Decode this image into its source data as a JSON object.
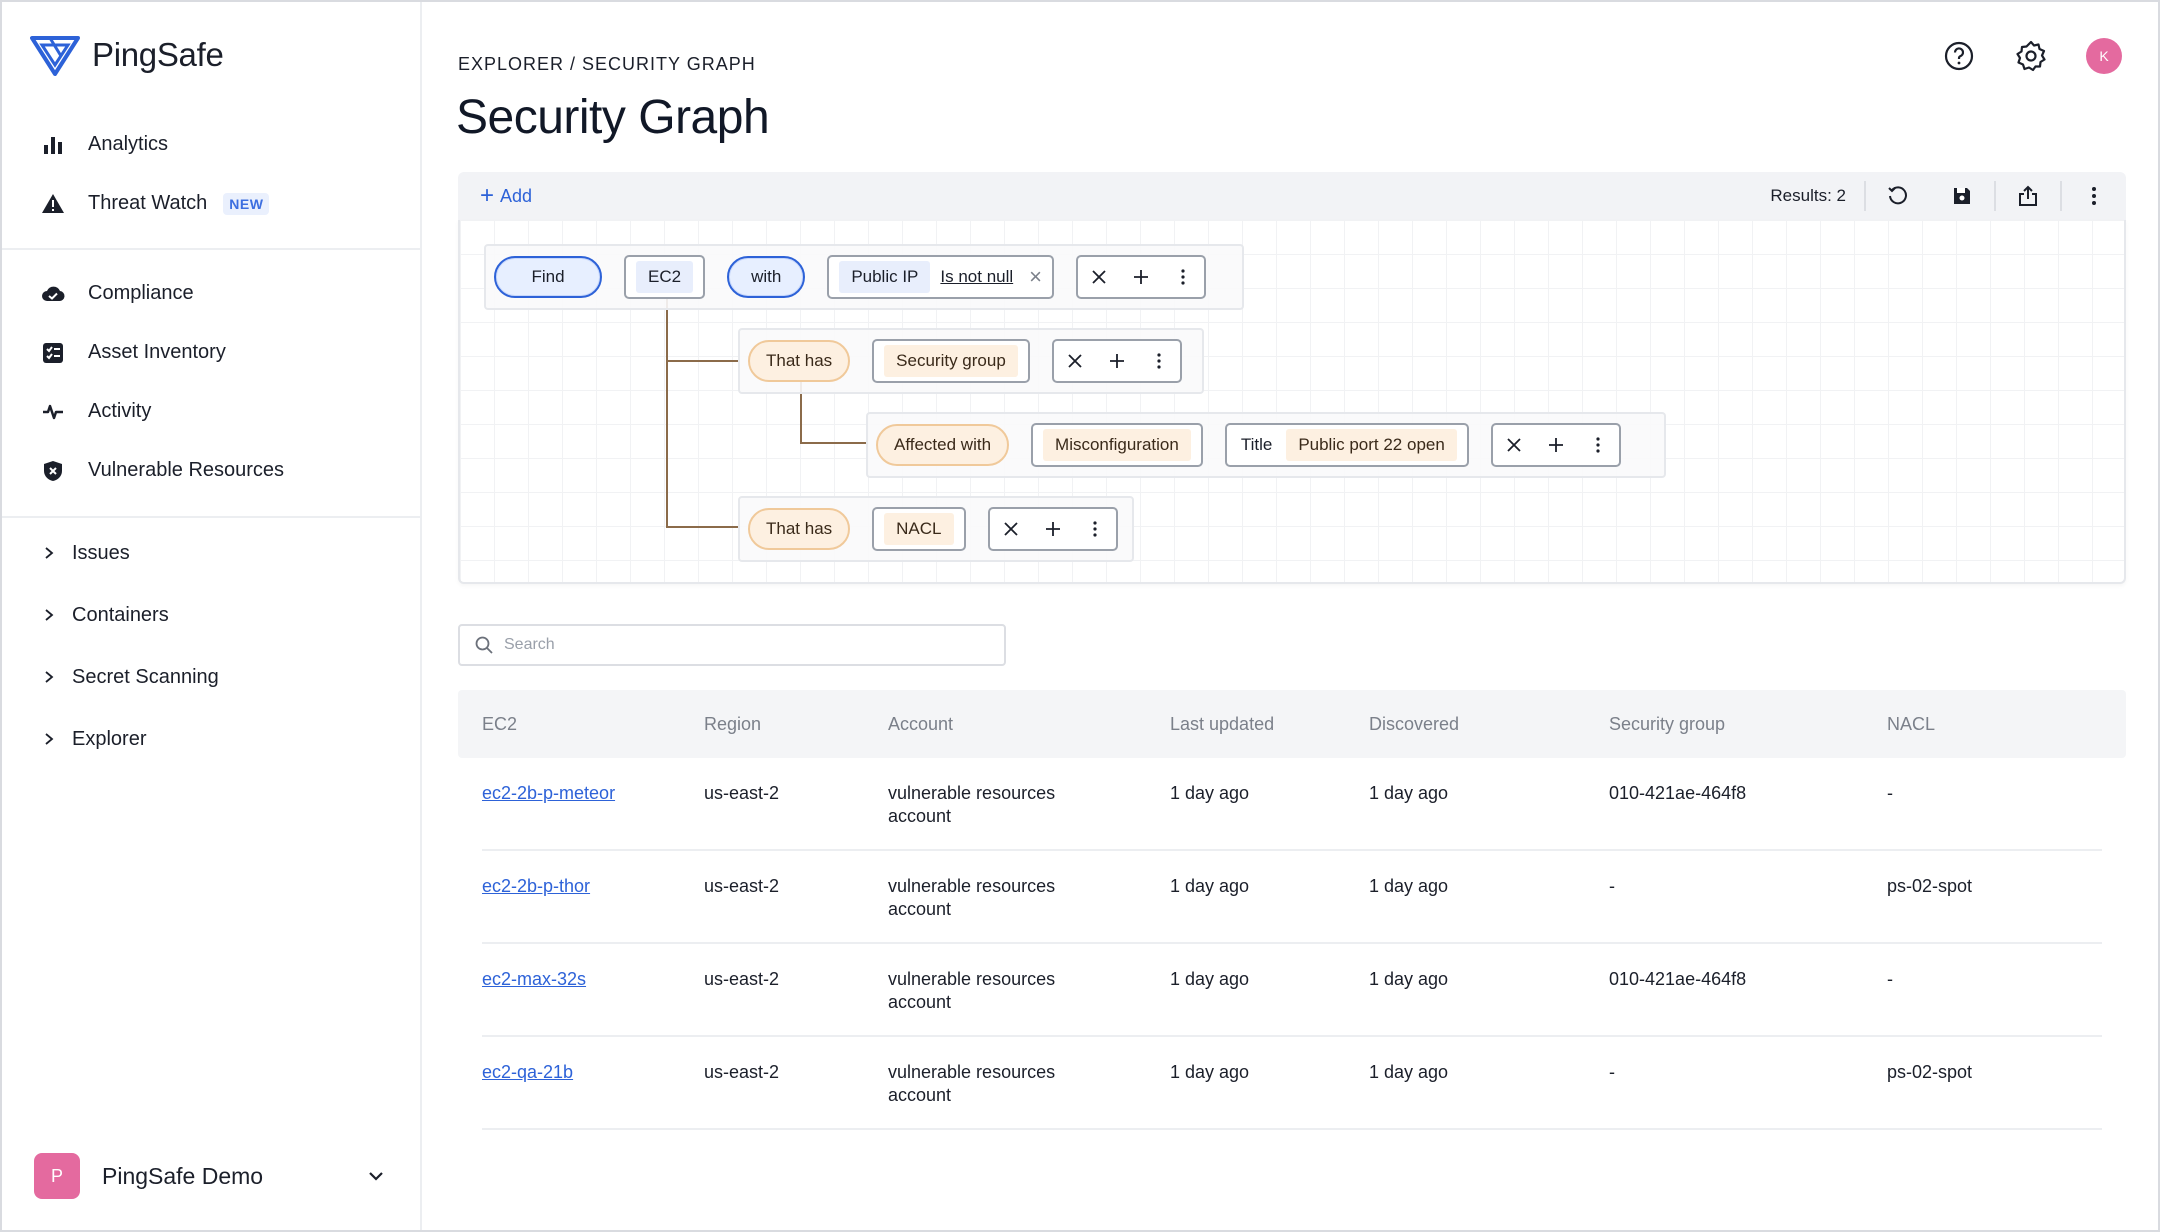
{
  "brand": {
    "name": "PingSafe"
  },
  "sidebar": {
    "primary": [
      {
        "label": "Analytics",
        "icon": "bar-chart-icon"
      },
      {
        "label": "Threat Watch",
        "icon": "warning-icon",
        "badge": "NEW"
      }
    ],
    "secondary": [
      {
        "label": "Compliance",
        "icon": "cloud-check-icon"
      },
      {
        "label": "Asset Inventory",
        "icon": "checklist-icon"
      },
      {
        "label": "Activity",
        "icon": "pulse-icon"
      },
      {
        "label": "Vulnerable Resources",
        "icon": "shield-x-icon"
      }
    ],
    "collapsible": [
      {
        "label": "Issues"
      },
      {
        "label": "Containers"
      },
      {
        "label": "Secret Scanning"
      },
      {
        "label": "Explorer"
      }
    ],
    "org": {
      "initial": "P",
      "name": "PingSafe Demo"
    }
  },
  "header": {
    "breadcrumb": "EXPLORER / SECURITY GRAPH",
    "title": "Security Graph",
    "user_initial": "K"
  },
  "toolbar": {
    "add_label": "Add",
    "results": "Results: 2"
  },
  "graph": {
    "row1": {
      "find": "Find",
      "entity": "EC2",
      "with": "with",
      "filter_key": "Public IP",
      "filter_op": "Is not null"
    },
    "row2": {
      "relation": "That has",
      "entity": "Security group"
    },
    "row3": {
      "relation": "Affected with",
      "entity": "Misconfiguration",
      "filter_key": "Title",
      "filter_value": "Public port 22 open"
    },
    "row4": {
      "relation": "That has",
      "entity": "NACL"
    }
  },
  "search": {
    "placeholder": "Search"
  },
  "table": {
    "columns": [
      "EC2",
      "Region",
      "Account",
      "Last updated",
      "Discovered",
      "Security group",
      "NACL"
    ],
    "rows": [
      {
        "ec2": "ec2-2b-p-meteor",
        "region": "us-east-2",
        "account_l1": "vulnerable resources",
        "account_l2": "account",
        "updated": "1 day ago",
        "discovered": "1 day ago",
        "sg": "010-421ae-464f8",
        "nacl": "-"
      },
      {
        "ec2": "ec2-2b-p-thor",
        "region": "us-east-2",
        "account_l1": "vulnerable resources",
        "account_l2": "account",
        "updated": "1 day ago",
        "discovered": "1 day ago",
        "sg": "-",
        "nacl": "ps-02-spot"
      },
      {
        "ec2": "ec2-max-32s",
        "region": "us-east-2",
        "account_l1": "vulnerable resources",
        "account_l2": "account",
        "updated": "1 day ago",
        "discovered": "1 day ago",
        "sg": "010-421ae-464f8",
        "nacl": "-"
      },
      {
        "ec2": "ec2-qa-21b",
        "region": "us-east-2",
        "account_l1": "vulnerable resources",
        "account_l2": "account",
        "updated": "1 day ago",
        "discovered": "1 day ago",
        "sg": "-",
        "nacl": "ps-02-spot"
      }
    ]
  },
  "colors": {
    "accent": "#2d62d8",
    "avatar": "#e46a9f",
    "relation_fill": "#fdf0e1",
    "relation_border": "#f0c99a"
  }
}
